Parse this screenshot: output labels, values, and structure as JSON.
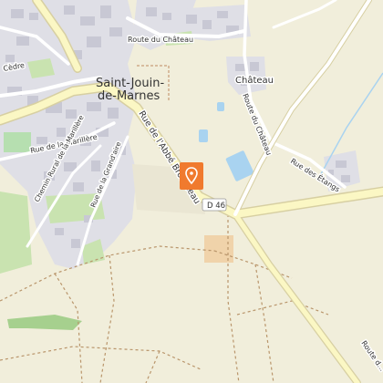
{
  "map": {
    "town_name_line1": "Saint-Jouin-",
    "town_name_line2": "de-Marnes",
    "hamlet_name": "Château",
    "road_shield": "D 46",
    "labels": {
      "route_du_chateau_north": "Route du Château",
      "route_du_chateau_east": "Route du Château",
      "rue_abbe_brousseau": "Rue de l'Abbé Brousseau",
      "rue_marillere": "Rue de la Marillère",
      "chemin_rural_marillere": "Chemin Rural de la Marillère",
      "rue_grande_aire": "Rue de la Grand'aire",
      "rue_des_etangs": "Rue des Étangs",
      "rue_cedre": "Cèdre",
      "route_se": "Route d..."
    },
    "marker_icon": "location-pin-icon",
    "colors": {
      "background": "#f1eedb",
      "builtup": "#dfdfe6",
      "building": "#c8c8d4",
      "main_road": "#fbf7c4",
      "road_casing": "#d7cfa2",
      "marker": "#f07a2e",
      "water": "#a9d3f0",
      "grass": "#c9e3b0",
      "field_green": "#a6d08e",
      "track": "#b9956b"
    }
  }
}
